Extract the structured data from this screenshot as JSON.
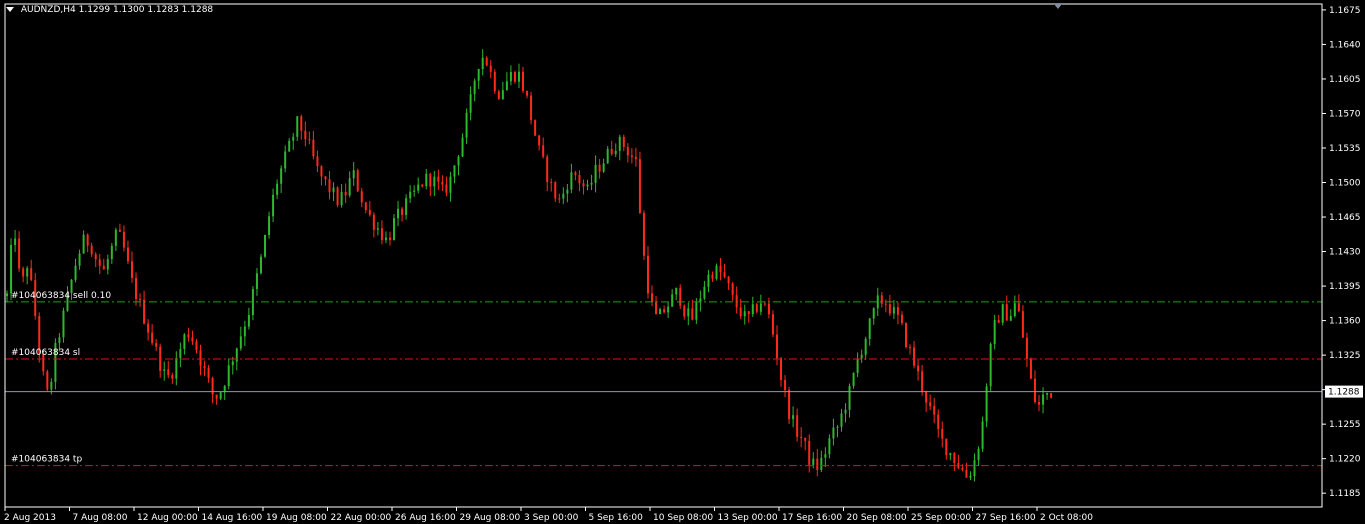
{
  "header": {
    "symbol": "AUDNZD,H4",
    "quote": "1.1299 1.1300 1.1283 1.1288"
  },
  "colors": {
    "background": "#000000",
    "frame": "#ffffff",
    "bull": "#2db82d",
    "bear": "#ff2a1a",
    "sell_line": "#1f9e1f",
    "order_line": "#e01515",
    "bid_line": "#8a9aac",
    "bid_tag_bg": "#ffffff",
    "bid_tag_text": "#000000"
  },
  "chart_data": {
    "type": "candlestick",
    "symbol": "AUDNZD",
    "timeframe": "H4",
    "ohlc_current": {
      "open": 1.1299,
      "high": 1.13,
      "low": 1.1283,
      "close": 1.1288
    },
    "ylim": [
      1.1171,
      1.1681
    ],
    "y_ticks": [
      "1.1675",
      "1.1640",
      "1.1605",
      "1.1570",
      "1.1535",
      "1.1500",
      "1.1465",
      "1.1430",
      "1.1395",
      "1.1360",
      "1.1325",
      "1.1290",
      "1.1255",
      "1.1220",
      "1.1185"
    ],
    "x_ticks": [
      "2 Aug 2013",
      "7 Aug 08:00",
      "12 Aug 00:00",
      "14 Aug 16:00",
      "19 Aug 08:00",
      "22 Aug 00:00",
      "26 Aug 16:00",
      "29 Aug 08:00",
      "3 Sep 00:00",
      "5 Sep 16:00",
      "10 Sep 08:00",
      "13 Sep 00:00",
      "17 Sep 16:00",
      "20 Sep 08:00",
      "25 Sep 00:00",
      "27 Sep 16:00",
      "2 Oct 08:00"
    ],
    "bars_between_ticks": 16,
    "price_path": [
      1.1385,
      1.146,
      1.139,
      1.142,
      1.137,
      1.131,
      1.128,
      1.133,
      1.136,
      1.139,
      1.142,
      1.144,
      1.144,
      1.142,
      1.141,
      1.143,
      1.145,
      1.143,
      1.14,
      1.138,
      1.136,
      1.134,
      1.132,
      1.13,
      1.131,
      1.133,
      1.135,
      1.134,
      1.132,
      1.13,
      1.128,
      1.129,
      1.131,
      1.133,
      1.135,
      1.137,
      1.14,
      1.143,
      1.147,
      1.15,
      1.152,
      1.154,
      1.156,
      1.155,
      1.153,
      1.151,
      1.15,
      1.149,
      1.148,
      1.149,
      1.151,
      1.149,
      1.147,
      1.146,
      1.145,
      1.144,
      1.146,
      1.147,
      1.148,
      1.149,
      1.15,
      1.1505,
      1.15,
      1.149,
      1.15,
      1.1525,
      1.155,
      1.158,
      1.162,
      1.163,
      1.161,
      1.159,
      1.16,
      1.161,
      1.161,
      1.159,
      1.156,
      1.153,
      1.151,
      1.149,
      1.148,
      1.15,
      1.151,
      1.15,
      1.149,
      1.151,
      1.152,
      1.153,
      1.154,
      1.154,
      1.153,
      1.152,
      1.143,
      1.138,
      1.136,
      1.137,
      1.138,
      1.139,
      1.137,
      1.136,
      1.138,
      1.14,
      1.141,
      1.141,
      1.14,
      1.138,
      1.137,
      1.136,
      1.137,
      1.138,
      1.137,
      1.134,
      1.13,
      1.127,
      1.125,
      1.124,
      1.122,
      1.121,
      1.122,
      1.124,
      1.125,
      1.127,
      1.129,
      1.132,
      1.134,
      1.136,
      1.138,
      1.138,
      1.137,
      1.136,
      1.134,
      1.132,
      1.13,
      1.128,
      1.126,
      1.124,
      1.123,
      1.122,
      1.121,
      1.12,
      1.122,
      1.125,
      1.132,
      1.136,
      1.137,
      1.1365,
      1.138,
      1.134,
      1.13,
      1.127,
      1.1285,
      1.1288
    ],
    "current_price": "1.1288",
    "order_lines": [
      {
        "label": "#104063834 sell 0.10",
        "price": 1.1379,
        "style": "dash-dot",
        "color": "#1f9e1f"
      },
      {
        "label": "#104063834 sl",
        "price": 1.1321,
        "style": "dash-dot",
        "color": "#e01515"
      },
      {
        "label": "#104063834 tp",
        "price": 1.1213,
        "style": "dash-dot",
        "color": "#e01515"
      }
    ],
    "title": "",
    "xlabel": "",
    "ylabel": "",
    "grid": false,
    "legend": "none"
  }
}
